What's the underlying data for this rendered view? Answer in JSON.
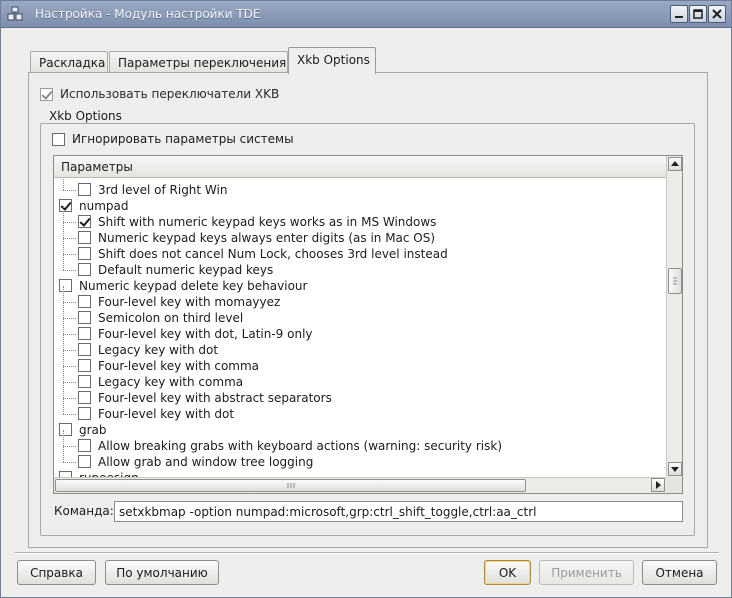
{
  "window": {
    "title": "Настройка - Модуль настройки TDE"
  },
  "tabs": [
    {
      "label": "Раскладка",
      "active": false
    },
    {
      "label": "Параметры переключения",
      "active": false
    },
    {
      "label": "Xkb Options",
      "active": true
    }
  ],
  "enable_switches": {
    "label": "Использовать переключатели XKB",
    "checked": true
  },
  "group": {
    "title": "Xkb Options",
    "ignore_system": {
      "label": "Игнорировать параметры системы",
      "checked": false
    }
  },
  "options_list": {
    "header": "Параметры",
    "rows": [
      {
        "text": "3rd level of Right Win",
        "level": 1,
        "checked": false
      },
      {
        "text": "numpad",
        "level": 0,
        "checked": true
      },
      {
        "text": "Shift with numeric keypad keys works as in MS Windows",
        "level": 1,
        "checked": true
      },
      {
        "text": "Numeric keypad keys always enter digits (as in Mac OS)",
        "level": 1,
        "checked": false
      },
      {
        "text": "Shift does not cancel Num Lock, chooses 3rd level instead",
        "level": 1,
        "checked": false
      },
      {
        "text": "Default numeric keypad keys",
        "level": 1,
        "checked": false
      },
      {
        "text": "Numeric keypad delete key behaviour",
        "level": 0,
        "checked": false
      },
      {
        "text": "Four-level key with momayyez",
        "level": 1,
        "checked": false
      },
      {
        "text": "Semicolon on third level",
        "level": 1,
        "checked": false
      },
      {
        "text": "Four-level key with dot, Latin-9 only",
        "level": 1,
        "checked": false
      },
      {
        "text": "Legacy key with dot",
        "level": 1,
        "checked": false
      },
      {
        "text": "Four-level key with comma",
        "level": 1,
        "checked": false
      },
      {
        "text": "Legacy key with comma",
        "level": 1,
        "checked": false
      },
      {
        "text": "Four-level key with abstract separators",
        "level": 1,
        "checked": false
      },
      {
        "text": "Four-level key with dot",
        "level": 1,
        "checked": false
      },
      {
        "text": "grab",
        "level": 0,
        "checked": false
      },
      {
        "text": "Allow breaking grabs with keyboard actions (warning: security risk)",
        "level": 1,
        "checked": false
      },
      {
        "text": "Allow grab and window tree logging",
        "level": 1,
        "checked": false
      },
      {
        "text": "rupeesign",
        "level": 0,
        "checked": false
      }
    ]
  },
  "command": {
    "label": "Команда:",
    "value": "setxkbmap -option numpad:microsoft,grp:ctrl_shift_toggle,ctrl:aa_ctrl"
  },
  "buttons": {
    "help": "Справка",
    "defaults": "По умолчанию",
    "ok": "OK",
    "apply": "Применить",
    "cancel": "Отмена"
  }
}
